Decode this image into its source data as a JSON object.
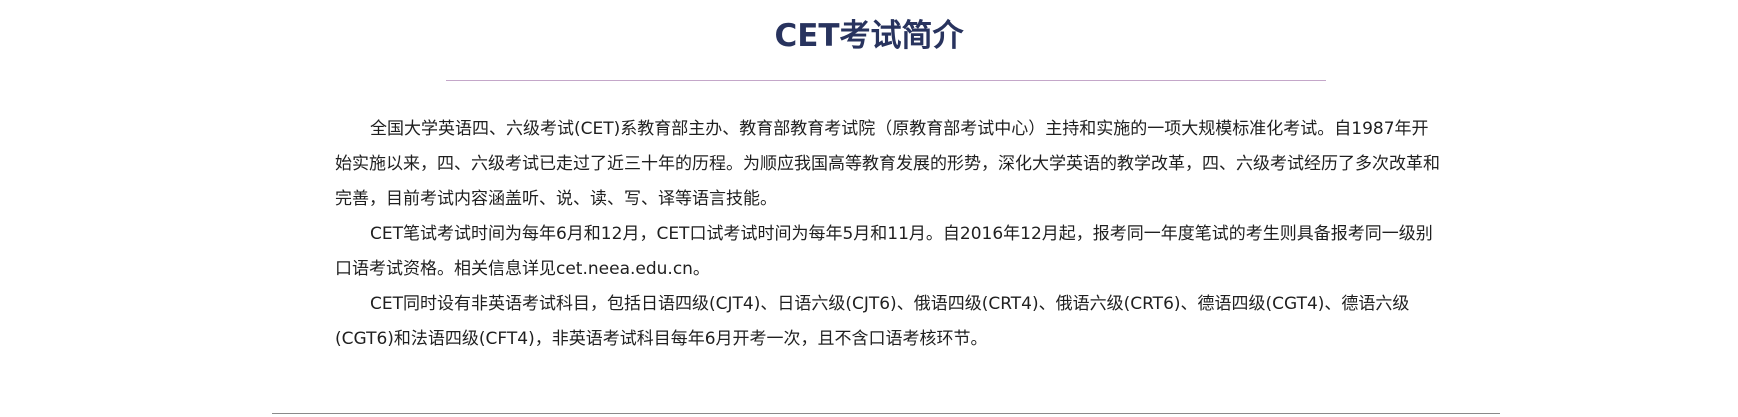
{
  "page": {
    "title": "CET考试简介"
  },
  "paragraphs": [
    "全国大学英语四、六级考试(CET)系教育部主办、教育部教育考试院（原教育部考试中心）主持和实施的一项大规模标准化考试。自1987年开始实施以来，四、六级考试已走过了近三十年的历程。为顺应我国高等教育发展的形势，深化大学英语的教学改革，四、六级考试经历了多次改革和完善，目前考试内容涵盖听、说、读、写、译等语言技能。",
    "CET笔试考试时间为每年6月和12月，CET口试考试时间为每年5月和11月。自2016年12月起，报考同一年度笔试的考生则具备报考同一级别口语考试资格。相关信息详见cet.neea.edu.cn。",
    "CET同时设有非英语考试科目，包括日语四级(CJT4)、日语六级(CJT6)、俄语四级(CRT4)、俄语六级(CRT6)、德语四级(CGT4)、德语六级(CGT6)和法语四级(CFT4)，非英语考试科目每年6月开考一次，且不含口语考核环节。"
  ],
  "colors": {
    "title": "#28335e",
    "title_rule": "#c4a7c9",
    "body_text": "#1f1f1f",
    "bottom_rule": "#8a8a8a"
  }
}
